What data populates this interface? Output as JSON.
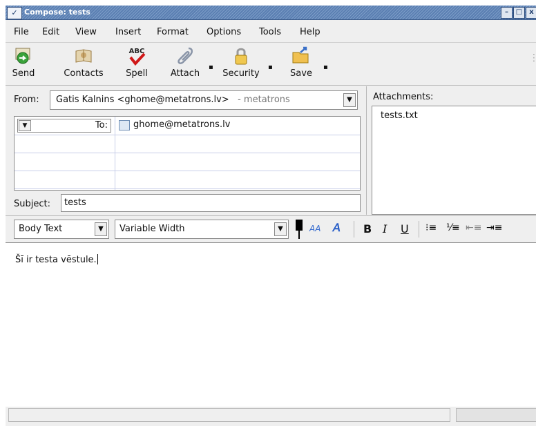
{
  "window": {
    "title": "Compose: tests"
  },
  "menu": [
    "File",
    "Edit",
    "View",
    "Insert",
    "Format",
    "Options",
    "Tools",
    "Help"
  ],
  "toolbar": {
    "send": "Send",
    "contacts": "Contacts",
    "spell": "Spell",
    "spell_icon_text": "ABC",
    "attach": "Attach",
    "security": "Security",
    "save": "Save"
  },
  "from": {
    "label": "From:",
    "value": "Gatis Kalnins <ghome@metatrons.lv>",
    "suffix": "- metatrons"
  },
  "recipients": [
    {
      "type": "To:",
      "address": "ghome@metatrons.lv"
    }
  ],
  "subject": {
    "label": "Subject:",
    "value": "tests"
  },
  "attachments": {
    "label": "Attachments:",
    "items": [
      "tests.txt"
    ]
  },
  "format_bar": {
    "paragraph_style": "Body Text",
    "font": "Variable Width"
  },
  "body": {
    "text": "Šī ir testa vēstule."
  }
}
